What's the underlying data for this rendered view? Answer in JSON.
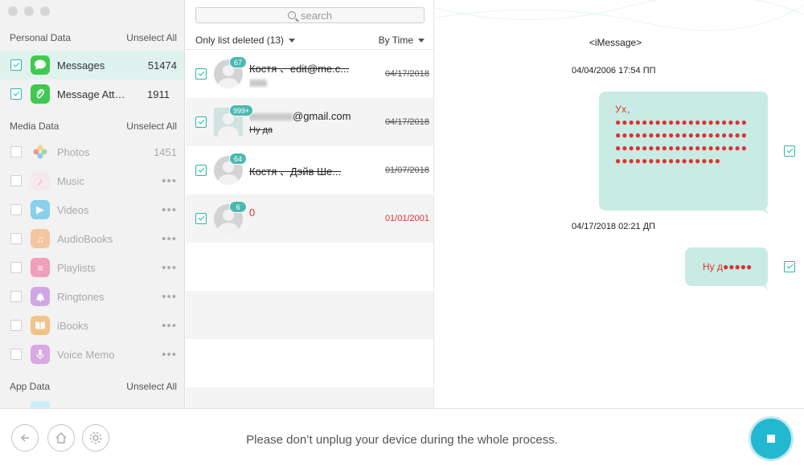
{
  "sidebar": {
    "personal_header": "Personal Data",
    "media_header": "Media Data",
    "app_header": "App Data",
    "unselect_label": "Unselect All",
    "personal_items": [
      {
        "name": "Messages",
        "count": "51474",
        "icon": "messages-icon",
        "color": "#3fc94f",
        "checked": true,
        "active": true
      },
      {
        "name": "Message Attachments",
        "count": "1911",
        "icon": "paperclip-icon",
        "color": "#3fc94f",
        "checked": true,
        "active": false
      }
    ],
    "media_items": [
      {
        "name": "Photos",
        "count": "1451",
        "icon": "photos-icon",
        "color": "#f6a623"
      },
      {
        "name": "Music",
        "count": "•••",
        "icon": "music-icon",
        "color": "#e96ca0"
      },
      {
        "name": "Videos",
        "count": "•••",
        "icon": "videos-icon",
        "color": "#35b6e8"
      },
      {
        "name": "AudioBooks",
        "count": "•••",
        "icon": "audiobooks-icon",
        "color": "#f2a35b"
      },
      {
        "name": "Playlists",
        "count": "•••",
        "icon": "playlists-icon",
        "color": "#f05a8b"
      },
      {
        "name": "Ringtones",
        "count": "•••",
        "icon": "ringtones-icon",
        "color": "#b46bdc"
      },
      {
        "name": "iBooks",
        "count": "•••",
        "icon": "ibooks-icon",
        "color": "#f39c33"
      },
      {
        "name": "Voice Memo",
        "count": "•••",
        "icon": "voice-memo-icon",
        "color": "#c86cdb"
      }
    ]
  },
  "list": {
    "search_placeholder": "search",
    "filter_label": "Only list deleted (13)",
    "sort_label": "By Time",
    "conversations": [
      {
        "badge": "67",
        "title": "Костя 、edit@me.c...",
        "sub": "",
        "date": "04/17/2018",
        "deleted": true
      },
      {
        "badge": "999+",
        "title": "@gmail.com",
        "sub": "Ну да",
        "date": "04/17/2018",
        "deleted": true
      },
      {
        "badge": "64",
        "title": "Костя 、Дэйв Ше...",
        "sub": "",
        "date": "01/07/2018",
        "deleted": true
      },
      {
        "badge": "6",
        "title": "0",
        "sub": "",
        "date": "01/01/2001",
        "deleted": false
      }
    ]
  },
  "detail": {
    "title": "<iMessage>",
    "stamp1": "04/04/2006 17:54 ПП",
    "msg1": "Ух, ●●●●●●●●●●●●●●●●●●●●●●●●●●●●●●●●●●●●●●●●●●●●●●●●●●●●●●●●●●●●●●●●●●●●●●●●●●●●",
    "stamp2": "04/17/2018 02:21 ДП",
    "msg2": "Ну д●●●●●"
  },
  "bottom": {
    "notice": "Please don’t unplug your device during the whole process."
  },
  "colors": {
    "accent": "#22b8cf",
    "bubble": "#c8ebe4",
    "deleted_red": "#e03030"
  }
}
